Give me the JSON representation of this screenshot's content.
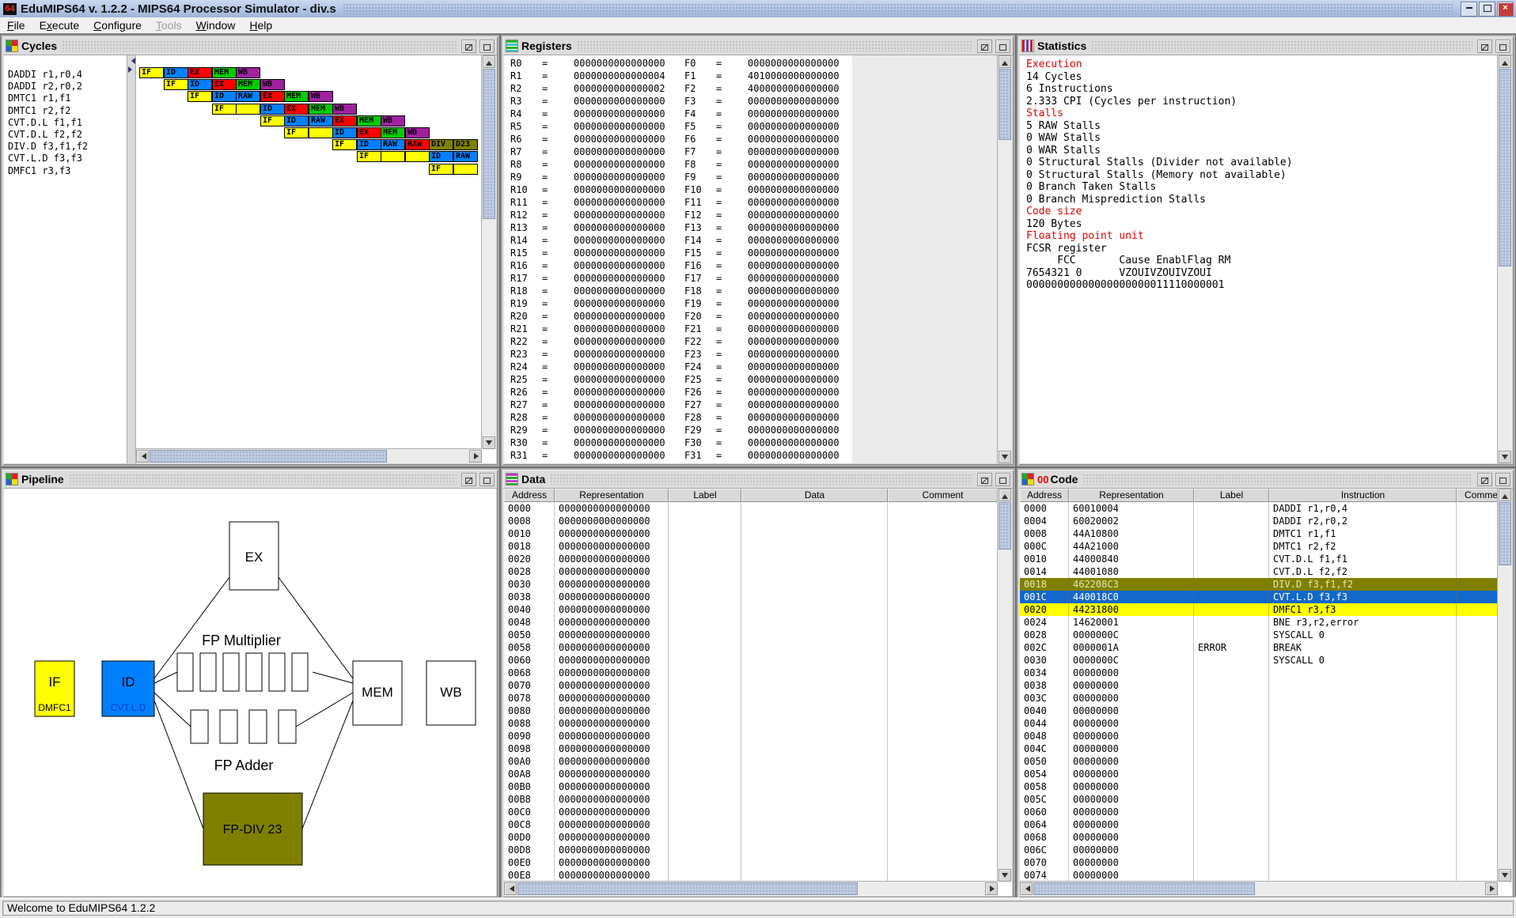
{
  "window": {
    "title": "EduMIPS64 v. 1.2.2 - MIPS64 Processor Simulator - div.s"
  },
  "icons": {
    "app_logo": "64",
    "close": "×",
    "maximize": "maximize",
    "iconify": "iconify"
  },
  "menu": {
    "items": [
      {
        "label": "File",
        "u": 0,
        "enabled": true
      },
      {
        "label": "Execute",
        "u": 1,
        "enabled": true
      },
      {
        "label": "Configure",
        "u": 0,
        "enabled": true
      },
      {
        "label": "Tools",
        "u": 0,
        "enabled": false
      },
      {
        "label": "Window",
        "u": 0,
        "enabled": true
      },
      {
        "label": "Help",
        "u": 0,
        "enabled": true
      }
    ]
  },
  "frames": {
    "cycles": {
      "title": "Cycles"
    },
    "registers": {
      "title": "Registers"
    },
    "statistics": {
      "title": "Statistics"
    },
    "pipeline": {
      "title": "Pipeline"
    },
    "data": {
      "title": "Data"
    },
    "code": {
      "title": "Code",
      "badge": "00"
    }
  },
  "colors": {
    "if": "#FFFF00",
    "id": "#0080FF",
    "ex": "#FF0000",
    "mem": "#00CC00",
    "wb": "#A020A0",
    "raw": "#0080FF",
    "raw_red": "#FF0000",
    "div": "#808000",
    "stall": "#FFFF00",
    "hl_olive": "#808000",
    "hl_blue": "#1268CC",
    "hl_yellow": "#FFFF00",
    "stat_red": "#E00000"
  },
  "cycles": {
    "instructions": [
      "DADDI r1,r0,4",
      "DADDI r2,r0,2",
      "DMTC1 r1,f1",
      "DMTC1 r2,f2",
      "CVT.D.L f1,f1",
      "CVT.D.L f2,f2",
      "DIV.D f3,f1,f2",
      "CVT.L.D f3,f3",
      "DMFC1 r3,f3"
    ],
    "grid": [
      [
        {
          "c": 1,
          "t": "IF",
          "k": "if"
        },
        {
          "c": 2,
          "t": "ID",
          "k": "id"
        },
        {
          "c": 3,
          "t": "EX",
          "k": "ex"
        },
        {
          "c": 4,
          "t": "MEM",
          "k": "mem"
        },
        {
          "c": 5,
          "t": "WB",
          "k": "wb"
        }
      ],
      [
        {
          "c": 2,
          "t": "IF",
          "k": "if"
        },
        {
          "c": 3,
          "t": "ID",
          "k": "id"
        },
        {
          "c": 4,
          "t": "EX",
          "k": "ex"
        },
        {
          "c": 5,
          "t": "MEM",
          "k": "mem"
        },
        {
          "c": 6,
          "t": "WB",
          "k": "wb"
        }
      ],
      [
        {
          "c": 3,
          "t": "IF",
          "k": "if"
        },
        {
          "c": 4,
          "t": "ID",
          "k": "id"
        },
        {
          "c": 5,
          "t": "RAW",
          "k": "raw"
        },
        {
          "c": 6,
          "t": "EX",
          "k": "ex"
        },
        {
          "c": 7,
          "t": "MEM",
          "k": "mem"
        },
        {
          "c": 8,
          "t": "WB",
          "k": "wb"
        }
      ],
      [
        {
          "c": 4,
          "t": "IF",
          "k": "if"
        },
        {
          "c": 5,
          "t": "",
          "k": "stall"
        },
        {
          "c": 6,
          "t": "ID",
          "k": "id"
        },
        {
          "c": 7,
          "t": "EX",
          "k": "ex"
        },
        {
          "c": 8,
          "t": "MEM",
          "k": "mem"
        },
        {
          "c": 9,
          "t": "WB",
          "k": "wb"
        }
      ],
      [
        {
          "c": 6,
          "t": "IF",
          "k": "if"
        },
        {
          "c": 7,
          "t": "ID",
          "k": "id"
        },
        {
          "c": 8,
          "t": "RAW",
          "k": "raw"
        },
        {
          "c": 9,
          "t": "EX",
          "k": "ex"
        },
        {
          "c": 10,
          "t": "MEM",
          "k": "mem"
        },
        {
          "c": 11,
          "t": "WB",
          "k": "wb"
        }
      ],
      [
        {
          "c": 7,
          "t": "IF",
          "k": "if"
        },
        {
          "c": 8,
          "t": "",
          "k": "stall"
        },
        {
          "c": 9,
          "t": "ID",
          "k": "id"
        },
        {
          "c": 10,
          "t": "EX",
          "k": "ex"
        },
        {
          "c": 11,
          "t": "MEM",
          "k": "mem"
        },
        {
          "c": 12,
          "t": "WB",
          "k": "wb"
        }
      ],
      [
        {
          "c": 9,
          "t": "IF",
          "k": "if"
        },
        {
          "c": 10,
          "t": "ID",
          "k": "id"
        },
        {
          "c": 11,
          "t": "RAW",
          "k": "raw"
        },
        {
          "c": 12,
          "t": "RAW",
          "k": "raw_red"
        },
        {
          "c": 13,
          "t": "DIV",
          "k": "div"
        },
        {
          "c": 14,
          "t": "D23",
          "k": "div"
        }
      ],
      [
        {
          "c": 10,
          "t": "IF",
          "k": "if"
        },
        {
          "c": 11,
          "t": "",
          "k": "stall"
        },
        {
          "c": 12,
          "t": "",
          "k": "stall"
        },
        {
          "c": 13,
          "t": "ID",
          "k": "id"
        },
        {
          "c": 14,
          "t": "RAW",
          "k": "raw"
        }
      ],
      [
        {
          "c": 13,
          "t": "IF",
          "k": "if"
        },
        {
          "c": 14,
          "t": "",
          "k": "stall"
        }
      ]
    ]
  },
  "registers": {
    "r_prefix": "R",
    "f_prefix": "F",
    "equals": "=",
    "r_values": [
      "0000000000000000",
      "0000000000000004",
      "0000000000000002",
      "0000000000000000",
      "0000000000000000",
      "0000000000000000",
      "0000000000000000",
      "0000000000000000",
      "0000000000000000",
      "0000000000000000",
      "0000000000000000",
      "0000000000000000",
      "0000000000000000",
      "0000000000000000",
      "0000000000000000",
      "0000000000000000",
      "0000000000000000",
      "0000000000000000",
      "0000000000000000",
      "0000000000000000",
      "0000000000000000",
      "0000000000000000",
      "0000000000000000",
      "0000000000000000",
      "0000000000000000",
      "0000000000000000",
      "0000000000000000",
      "0000000000000000",
      "0000000000000000",
      "0000000000000000",
      "0000000000000000",
      "0000000000000000"
    ],
    "f_values": [
      "0000000000000000",
      "4010000000000000",
      "4000000000000000",
      "0000000000000000",
      "0000000000000000",
      "0000000000000000",
      "0000000000000000",
      "0000000000000000",
      "0000000000000000",
      "0000000000000000",
      "0000000000000000",
      "0000000000000000",
      "0000000000000000",
      "0000000000000000",
      "0000000000000000",
      "0000000000000000",
      "0000000000000000",
      "0000000000000000",
      "0000000000000000",
      "0000000000000000",
      "0000000000000000",
      "0000000000000000",
      "0000000000000000",
      "0000000000000000",
      "0000000000000000",
      "0000000000000000",
      "0000000000000000",
      "0000000000000000",
      "0000000000000000",
      "0000000000000000",
      "0000000000000000",
      "0000000000000000"
    ]
  },
  "statistics": {
    "lines": [
      {
        "t": "Execution",
        "red": true
      },
      {
        "t": "14 Cycles",
        "red": false
      },
      {
        "t": "6 Instructions",
        "red": false
      },
      {
        "t": "2.333 CPI (Cycles per instruction)",
        "red": false
      },
      {
        "t": "Stalls",
        "red": true
      },
      {
        "t": "5 RAW Stalls",
        "red": false
      },
      {
        "t": "0 WAW Stalls",
        "red": false
      },
      {
        "t": "0 WAR Stalls",
        "red": false
      },
      {
        "t": "0 Structural Stalls (Divider not available)",
        "red": false
      },
      {
        "t": "0 Structural Stalls (Memory not available)",
        "red": false
      },
      {
        "t": "0 Branch Taken Stalls",
        "red": false
      },
      {
        "t": "0 Branch Misprediction Stalls",
        "red": false
      },
      {
        "t": "Code size",
        "red": true
      },
      {
        "t": "120 Bytes",
        "red": false
      },
      {
        "t": "Floating point unit",
        "red": true
      },
      {
        "t": "FCSR register",
        "red": false
      },
      {
        "t": "     FCC       Cause EnablFlag RM",
        "red": false
      },
      {
        "t": "7654321 0      VZOUIVZOUIVZOUI",
        "red": false
      },
      {
        "t": "00000000000000000000011110000001",
        "red": false
      }
    ]
  },
  "pipeline": {
    "if_label": "IF",
    "if_sub": "DMFC1",
    "id_label": "ID",
    "id_sub": "CVT.L.D",
    "ex_label": "EX",
    "mult_label": "FP Multiplier",
    "mult_stages": 6,
    "adder_label": "FP Adder",
    "adder_stages": 4,
    "div_label": "FP-DIV 23",
    "mem_label": "MEM",
    "wb_label": "WB"
  },
  "data_table": {
    "headers": [
      "Address",
      "Representation",
      "Label",
      "Data",
      "Comment"
    ],
    "rep_value": "0000000000000000",
    "addresses": [
      "0000",
      "0008",
      "0010",
      "0018",
      "0020",
      "0028",
      "0030",
      "0038",
      "0040",
      "0048",
      "0050",
      "0058",
      "0060",
      "0068",
      "0070",
      "0078",
      "0080",
      "0088",
      "0090",
      "0098",
      "00A0",
      "00A8",
      "00B0",
      "00B8",
      "00C0",
      "00C8",
      "00D0",
      "00D8",
      "00E0",
      "00E8"
    ]
  },
  "code_table": {
    "headers": [
      "Address",
      "Representation",
      "Label",
      "Instruction",
      "Comment"
    ],
    "rows": [
      {
        "addr": "0000",
        "rep": "60010004",
        "label": "",
        "instr": "DADDI r1,r0,4",
        "hl": ""
      },
      {
        "addr": "0004",
        "rep": "60020002",
        "label": "",
        "instr": "DADDI r2,r0,2",
        "hl": ""
      },
      {
        "addr": "0008",
        "rep": "44A10800",
        "label": "",
        "instr": "DMTC1 r1,f1",
        "hl": ""
      },
      {
        "addr": "000C",
        "rep": "44A21000",
        "label": "",
        "instr": "DMTC1 r2,f2",
        "hl": ""
      },
      {
        "addr": "0010",
        "rep": "44000840",
        "label": "",
        "instr": "CVT.D.L f1,f1",
        "hl": ""
      },
      {
        "addr": "0014",
        "rep": "44001080",
        "label": "",
        "instr": "CVT.D.L f2,f2",
        "hl": ""
      },
      {
        "addr": "0018",
        "rep": "462208C3",
        "label": "",
        "instr": "DIV.D f3,f1,f2",
        "hl": "olive"
      },
      {
        "addr": "001C",
        "rep": "440018C0",
        "label": "",
        "instr": "CVT.L.D f3,f3",
        "hl": "blue"
      },
      {
        "addr": "0020",
        "rep": "44231800",
        "label": "",
        "instr": "DMFC1 r3,f3",
        "hl": "yellow"
      },
      {
        "addr": "0024",
        "rep": "14620001",
        "label": "",
        "instr": "BNE r3,r2,error",
        "hl": ""
      },
      {
        "addr": "0028",
        "rep": "0000000C",
        "label": "",
        "instr": "SYSCALL 0",
        "hl": ""
      },
      {
        "addr": "002C",
        "rep": "0000001A",
        "label": "ERROR",
        "instr": "BREAK",
        "hl": ""
      },
      {
        "addr": "0030",
        "rep": "0000000C",
        "label": "",
        "instr": "SYSCALL 0",
        "hl": ""
      },
      {
        "addr": "0034",
        "rep": "00000000",
        "label": "",
        "instr": "",
        "hl": ""
      },
      {
        "addr": "0038",
        "rep": "00000000",
        "label": "",
        "instr": "",
        "hl": ""
      },
      {
        "addr": "003C",
        "rep": "00000000",
        "label": "",
        "instr": "",
        "hl": ""
      },
      {
        "addr": "0040",
        "rep": "00000000",
        "label": "",
        "instr": "",
        "hl": ""
      },
      {
        "addr": "0044",
        "rep": "00000000",
        "label": "",
        "instr": "",
        "hl": ""
      },
      {
        "addr": "0048",
        "rep": "00000000",
        "label": "",
        "instr": "",
        "hl": ""
      },
      {
        "addr": "004C",
        "rep": "00000000",
        "label": "",
        "instr": "",
        "hl": ""
      },
      {
        "addr": "0050",
        "rep": "00000000",
        "label": "",
        "instr": "",
        "hl": ""
      },
      {
        "addr": "0054",
        "rep": "00000000",
        "label": "",
        "instr": "",
        "hl": ""
      },
      {
        "addr": "0058",
        "rep": "00000000",
        "label": "",
        "instr": "",
        "hl": ""
      },
      {
        "addr": "005C",
        "rep": "00000000",
        "label": "",
        "instr": "",
        "hl": ""
      },
      {
        "addr": "0060",
        "rep": "00000000",
        "label": "",
        "instr": "",
        "hl": ""
      },
      {
        "addr": "0064",
        "rep": "00000000",
        "label": "",
        "instr": "",
        "hl": ""
      },
      {
        "addr": "0068",
        "rep": "00000000",
        "label": "",
        "instr": "",
        "hl": ""
      },
      {
        "addr": "006C",
        "rep": "00000000",
        "label": "",
        "instr": "",
        "hl": ""
      },
      {
        "addr": "0070",
        "rep": "00000000",
        "label": "",
        "instr": "",
        "hl": ""
      },
      {
        "addr": "0074",
        "rep": "00000000",
        "label": "",
        "instr": "",
        "hl": ""
      }
    ]
  },
  "status_bar": {
    "text": "Welcome to EduMIPS64 1.2.2"
  }
}
